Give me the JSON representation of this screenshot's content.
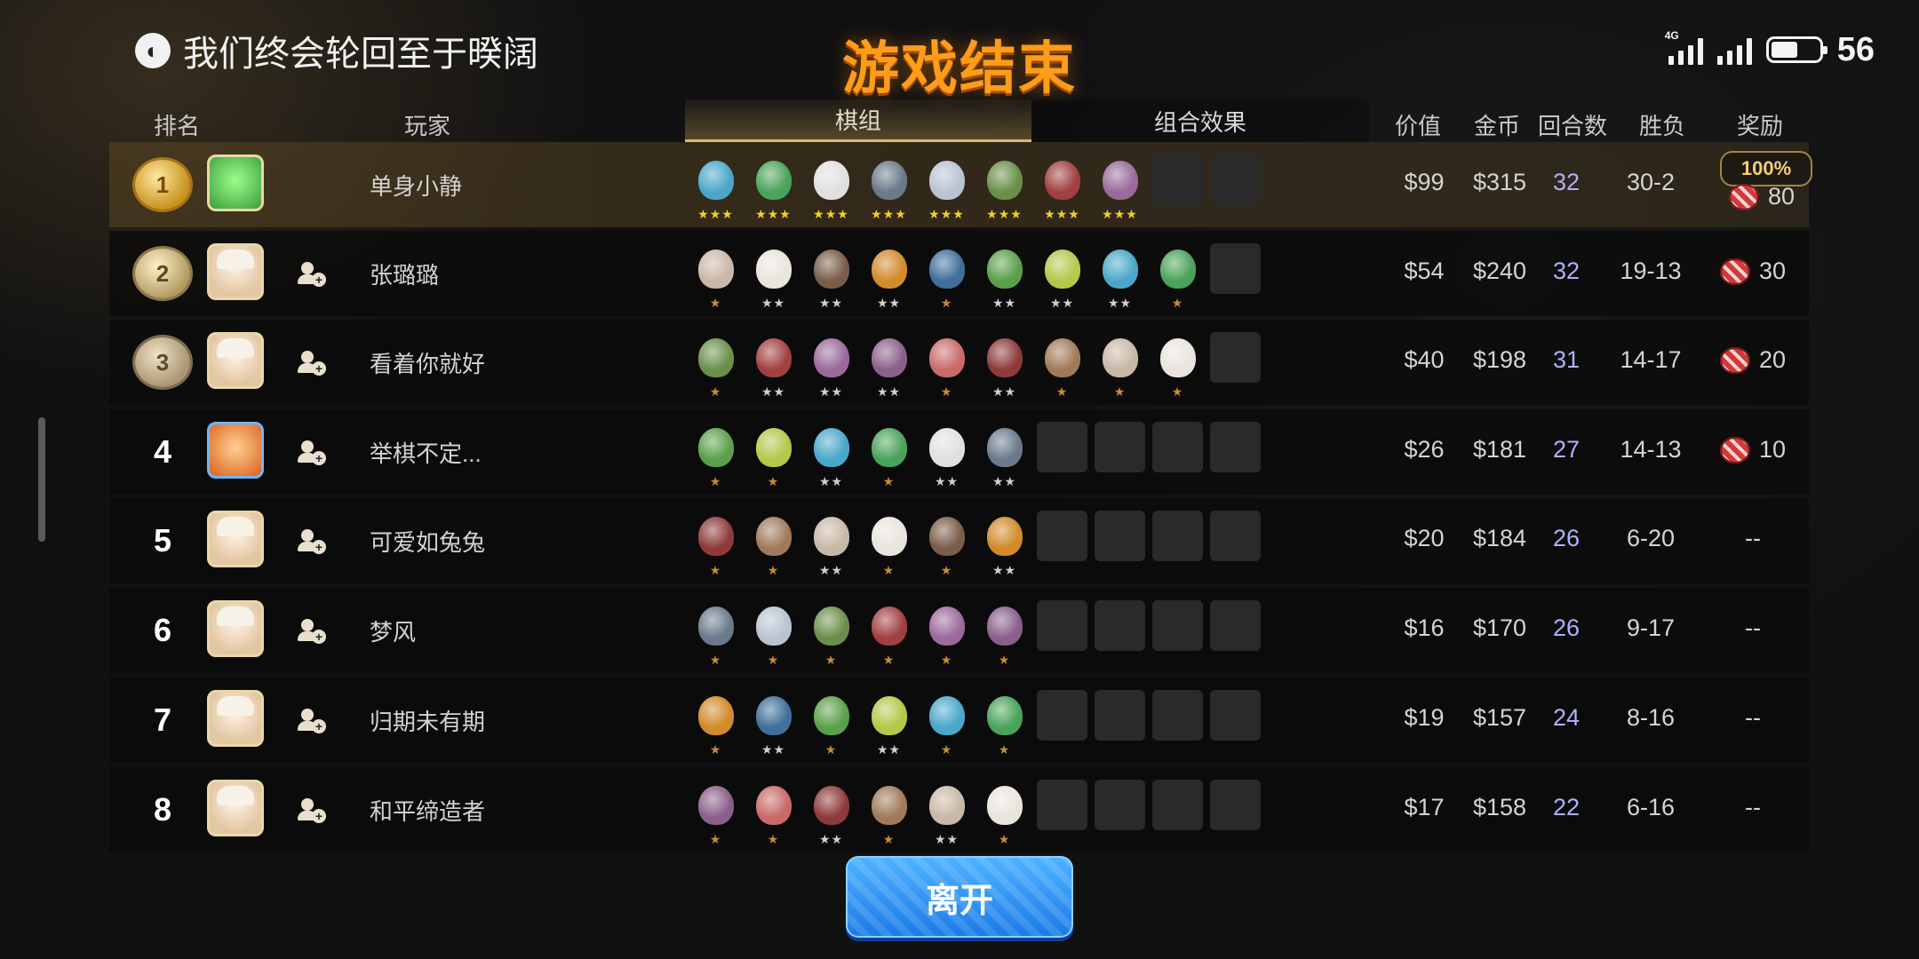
{
  "room_title": "我们终会轮回至于暌阔",
  "game_over": "游戏结束",
  "status_bar": {
    "network_tag": "4G",
    "battery": "56"
  },
  "header": {
    "rank": "排名",
    "player": "玩家",
    "tab_board": "棋组",
    "tab_synergy": "组合效果",
    "value": "价值",
    "gold": "金币",
    "rounds": "回合数",
    "win_loss": "胜负",
    "reward": "奖励"
  },
  "rows": [
    {
      "rank": "",
      "medal": "gold",
      "name": "单身小静",
      "value": "$99",
      "gold": "$315",
      "rounds": "32",
      "wl": "30-2",
      "reward_pct": "100%",
      "reward": "80"
    },
    {
      "rank": "",
      "medal": "silver",
      "name": "张璐璐",
      "value": "$54",
      "gold": "$240",
      "rounds": "32",
      "wl": "19-13",
      "reward": "30"
    },
    {
      "rank": "",
      "medal": "bronze",
      "name": "看着你就好",
      "value": "$40",
      "gold": "$198",
      "rounds": "31",
      "wl": "14-17",
      "reward": "20"
    },
    {
      "rank": "4",
      "name": "举棋不定...",
      "value": "$26",
      "gold": "$181",
      "rounds": "27",
      "wl": "14-13",
      "reward": "10"
    },
    {
      "rank": "5",
      "name": "可爱如兔兔",
      "value": "$20",
      "gold": "$184",
      "rounds": "26",
      "wl": "6-20",
      "reward": "--"
    },
    {
      "rank": "6",
      "name": "梦风",
      "value": "$16",
      "gold": "$170",
      "rounds": "26",
      "wl": "9-17",
      "reward": "--"
    },
    {
      "rank": "7",
      "name": "归期未有期",
      "value": "$19",
      "gold": "$157",
      "rounds": "24",
      "wl": "8-16",
      "reward": "--"
    },
    {
      "rank": "8",
      "name": "和平缔造者",
      "value": "$17",
      "gold": "$158",
      "rounds": "22",
      "wl": "6-16",
      "reward": "--"
    }
  ],
  "boards": [
    [
      3,
      3,
      3,
      3,
      3,
      3,
      3,
      3,
      0,
      0
    ],
    [
      1,
      2,
      2,
      2,
      1,
      2,
      2,
      2,
      1,
      0
    ],
    [
      1,
      2,
      2,
      2,
      1,
      2,
      1,
      1,
      1,
      0
    ],
    [
      1,
      1,
      2,
      1,
      2,
      2,
      0,
      0,
      0,
      0
    ],
    [
      1,
      1,
      2,
      1,
      1,
      2,
      0,
      0,
      0,
      0
    ],
    [
      1,
      1,
      1,
      1,
      1,
      1,
      0,
      0,
      0,
      0
    ],
    [
      1,
      2,
      1,
      2,
      1,
      1,
      0,
      0,
      0,
      0
    ],
    [
      1,
      1,
      2,
      1,
      2,
      1,
      0,
      0,
      0,
      0
    ]
  ],
  "colors": {
    "accent": "#ff9c1a",
    "rounds_text": "#aeb2ff",
    "row_bg": "#0a0a0a",
    "palette": [
      "#4aa7c9",
      "#b9c3d1",
      "#8a5f8a",
      "#c9b8a8",
      "#3f6f9a",
      "#4aa35a",
      "#6b8f4a",
      "#c86a6a",
      "#e9e4dc",
      "#5aa04a",
      "#e0e0e0",
      "#a04040",
      "#8f3a3a",
      "#7a5c4a",
      "#b4c84a",
      "#6a7a8a",
      "#9a6a9a",
      "#a07a5a",
      "#d28a2a"
    ]
  },
  "leave_button": "离开"
}
